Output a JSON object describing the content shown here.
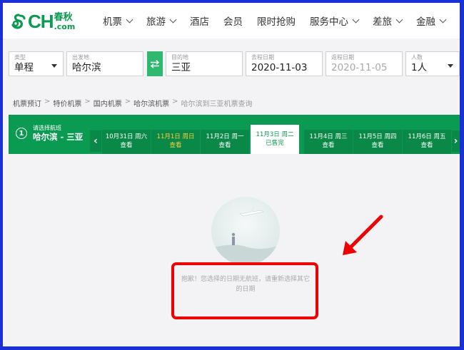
{
  "logo": {
    "brand": "CH",
    "cn": "春秋",
    "domain": ".com"
  },
  "nav": [
    {
      "label": "机票",
      "dropdown": true
    },
    {
      "label": "旅游",
      "dropdown": true
    },
    {
      "label": "酒店",
      "dropdown": false
    },
    {
      "label": "会员",
      "dropdown": false
    },
    {
      "label": "限时抢购",
      "dropdown": false
    },
    {
      "label": "服务中心",
      "dropdown": true
    },
    {
      "label": "差旅",
      "dropdown": true
    },
    {
      "label": "金融",
      "dropdown": true
    }
  ],
  "search": {
    "type": {
      "label": "类型",
      "value": "单程"
    },
    "from": {
      "label": "出发地",
      "value": "哈尔滨"
    },
    "to": {
      "label": "目的地",
      "value": "三亚"
    },
    "depart": {
      "label": "去程日期",
      "value": "2020-11-03"
    },
    "return": {
      "label": "返程日期",
      "value": "2020-11-05"
    },
    "pax": {
      "label": "人数",
      "value": "1人"
    }
  },
  "breadcrumb": [
    "机票预订",
    "特价机票",
    "国内机票",
    "哈尔滨机票",
    "哈尔滨到三亚机票查询"
  ],
  "flight_select": {
    "step": "1",
    "hint": "请选择航班",
    "route": "哈尔滨 - 三亚"
  },
  "days": [
    {
      "date": "10月31日 周六",
      "status": "查看"
    },
    {
      "date": "11月1日 周日",
      "status": "查看"
    },
    {
      "date": "11月2日 周一",
      "status": "查看"
    },
    {
      "date": "11月3日 周二",
      "status": "已售完"
    },
    {
      "date": "11月4日 周三",
      "status": "查看"
    },
    {
      "date": "11月5日 周四",
      "status": "查看"
    },
    {
      "date": "11月6日 周五",
      "status": "查看"
    }
  ],
  "empty_message": "抱歉！您选择的日期无航班，请重新选择其它的日期",
  "colors": {
    "brand_green": "#0b9a51",
    "highlight_yellow": "#ffd23a",
    "annotation_red": "#e00000"
  }
}
